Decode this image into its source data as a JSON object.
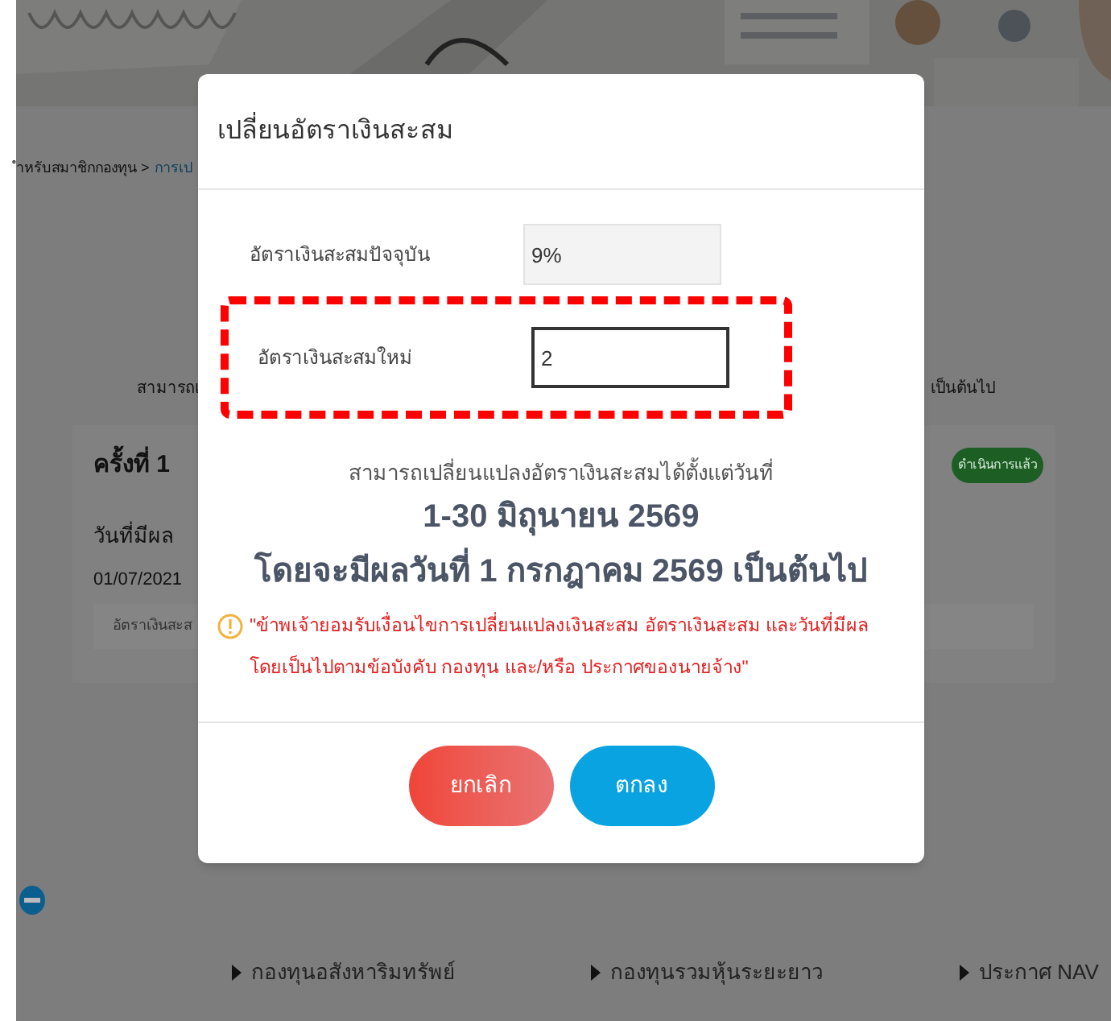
{
  "page": {
    "breadcrumb": {
      "text": "ำหรับสมาชิกกองทุน >",
      "link": "การเป"
    },
    "notice_left": "สามารถเ",
    "notice_right": "เป็นต้นไป",
    "card": {
      "title": "ครั้งที่ 1",
      "status": "ดำเนินการแล้ว",
      "date_label": "วันที่มีผล",
      "date_value": "01/07/2021",
      "rate_label": "อัตราเงินสะส"
    },
    "footer_links": [
      "กองทุนอสังหาริมทรัพย์",
      "กองทุนรวมหุ้นระยะยาว",
      "ประกาศ NAV"
    ]
  },
  "dialog": {
    "title": "เปลี่ยนอัตราเงินสะสม",
    "fields": [
      {
        "label": "อัตราเงินสะสมปัจจุบัน",
        "value": "9%",
        "disabled": true,
        "highlighted": false
      },
      {
        "label": "อัตราเงินสะสมใหม่",
        "value": "2",
        "disabled": false,
        "highlighted": true
      }
    ],
    "message": "สามารถเปลี่ยนแปลงอัตราเงินสะสมได้ตั้งแต่วันที่",
    "period": "1-30 มิถุนายน 2569",
    "effective": "โดยจะมีผลวันที่ 1 กรกฎาคม 2569 เป็นต้นไป",
    "warning": "\"ข้าพเจ้ายอมรับเงื่อนไขการเปลี่ยนแปลงเงินสะสม อัตราเงินสะสม และวันที่มีผล โดยเป็นไปตามข้อบังคับ กองทุน และ/หรือ ประกาศของนายจ้าง\"",
    "buttons": [
      {
        "label": "ยกเลิก",
        "kind": "cancel"
      },
      {
        "label": "ตกลง",
        "kind": "confirm"
      }
    ]
  }
}
